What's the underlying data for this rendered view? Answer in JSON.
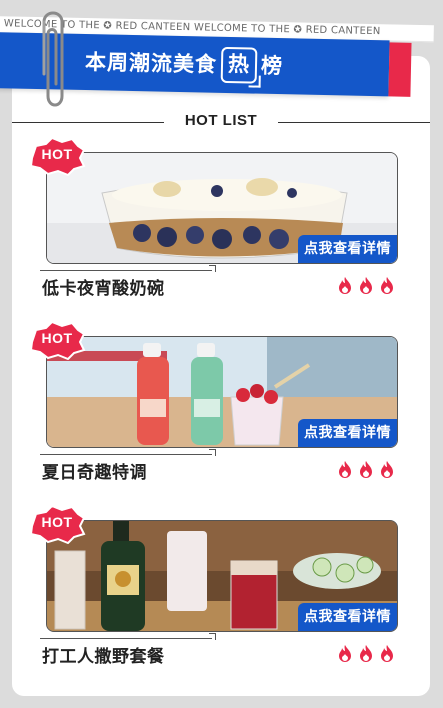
{
  "banner": {
    "marquee": "WELCOME TO THE  ✪  RED CANTEEN   WELCOME TO THE  ✪  RED CANTEEN",
    "title_before": "本周潮流美食",
    "title_box": "热",
    "title_after": "榜"
  },
  "section": {
    "heading": "HOT LIST"
  },
  "items": [
    {
      "badge": "HOT",
      "name": "低卡夜宵酸奶碗",
      "button": "点我查看详情",
      "rating": 3
    },
    {
      "badge": "HOT",
      "name": "夏日奇趣特调",
      "button": "点我查看详情",
      "rating": 3
    },
    {
      "badge": "HOT",
      "name": "打工人撒野套餐",
      "button": "点我查看详情",
      "rating": 3
    }
  ],
  "colors": {
    "brand_blue": "#1457c9",
    "accent_red": "#e8294a",
    "fire_red": "#e8294a"
  }
}
